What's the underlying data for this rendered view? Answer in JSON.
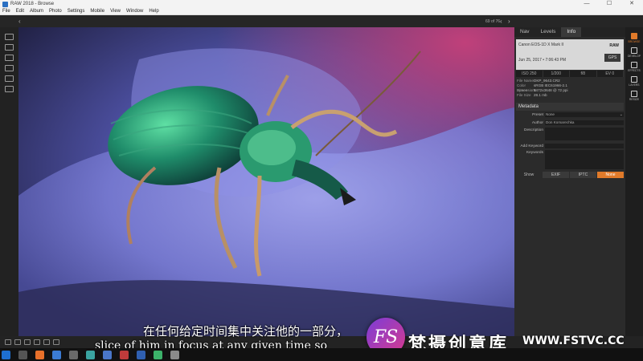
{
  "window": {
    "title": "RAW 2018 - Browse",
    "minimize": "—",
    "maximize": "☐",
    "close": "✕"
  },
  "menu": [
    "File",
    "Edit",
    "Album",
    "Photo",
    "Settings",
    "Mobile",
    "View",
    "Window",
    "Help"
  ],
  "browse": {
    "back_icon": "‹",
    "counter": "69 of 76",
    "prev_icon": "‹",
    "next_icon": "›"
  },
  "left_tools": [
    "monitor-icon",
    "camera-icon",
    "folder-icon",
    "drive-icon",
    "cloud-icon",
    "album-icon"
  ],
  "panel": {
    "tabs": [
      {
        "label": "Nav",
        "active": false
      },
      {
        "label": "Levels",
        "active": false
      },
      {
        "label": "Info",
        "active": true
      }
    ],
    "info": {
      "camera": "Canon EOS-1D X Mark II",
      "format": "RAW",
      "date": "Jun 25, 2017 • 7:06:43 PM",
      "gps": "GPS",
      "exif": [
        "ISO 250",
        "1/200",
        "f/8",
        "EV 0"
      ],
      "file_rows": [
        {
          "key": "File Name",
          "value": "DKP_9643.CR2"
        },
        {
          "key": "Color Space",
          "value": "sRGB IEC61966-2.1"
        },
        {
          "key": "Dimensions",
          "value": "5472x3648 @ 72 ppi"
        },
        {
          "key": "File Size",
          "value": "28.1 mb"
        }
      ]
    },
    "metadata": {
      "header": "Metadata",
      "preset_label": "Preset",
      "preset_value": "None",
      "author_label": "Author",
      "author_value": "Don Komarechka",
      "description_label": "Description",
      "add_keyword_label": "Add Keyword",
      "keywords_label": "Keywords",
      "show_label": "Show",
      "show_buttons": [
        {
          "label": "EXIF",
          "active": false
        },
        {
          "label": "IPTC",
          "active": false
        },
        {
          "label": "None",
          "active": true
        }
      ]
    }
  },
  "modules": [
    {
      "label": "BROWSE",
      "icon": "browse-icon",
      "active": true
    },
    {
      "label": "DEVELOP",
      "icon": "develop-icon",
      "active": false
    },
    {
      "label": "EFFECTS",
      "icon": "effects-icon",
      "active": false
    },
    {
      "label": "LAYERS",
      "icon": "layers-icon",
      "active": false
    },
    {
      "label": "RESIZE",
      "icon": "resize-icon",
      "active": false
    }
  ],
  "subtitles": {
    "chinese": "在任何给定时间集中关注他的一部分，",
    "english": "slice of him in focus at any given time so"
  },
  "watermark": {
    "logo": "FS",
    "name": "梵摄创意库",
    "url": "WWW.FSTVC.CC"
  },
  "colors": {
    "accent": "#e07a2a",
    "panel_bg": "#2b2b2b"
  }
}
